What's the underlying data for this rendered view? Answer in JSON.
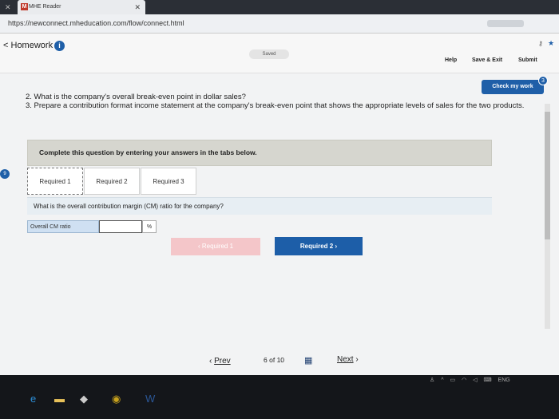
{
  "browser": {
    "tab_title": "MHE Reader",
    "tab_favicon": "M",
    "url": "https://newconnect.mheducation.com/flow/connect.html"
  },
  "header": {
    "title": "Homework",
    "saved": "Saved",
    "help": "Help",
    "save_exit": "Save & Exit",
    "submit": "Submit",
    "check_my_work": "Check my work",
    "check_badge": "3"
  },
  "question": {
    "line2": "2. What is the company's overall break-even point in dollar sales?",
    "line3": "3. Prepare a contribution format income statement at the company's break-even point that shows the appropriate levels of sales for the two products."
  },
  "instructions": "Complete this question by entering your answers in the tabs below.",
  "tabs": [
    {
      "label": "Required 1"
    },
    {
      "label": "Required 2"
    },
    {
      "label": "Required 3"
    }
  ],
  "side_badge": "9",
  "prompt": "What is the overall contribution margin (CM) ratio for the company?",
  "cm_field": {
    "label": "Overall CM ratio",
    "value": "",
    "unit": "%"
  },
  "nav_buttons": {
    "prev": "Required 1",
    "next": "Required 2"
  },
  "footer": {
    "prev": "Prev",
    "current": "6",
    "of": "of",
    "total": "10",
    "next": "Next"
  },
  "taskbar": {
    "lang": "ENG"
  },
  "colors": {
    "accent": "#1f5fa8",
    "instruction_bg": "#d6d6cf"
  }
}
